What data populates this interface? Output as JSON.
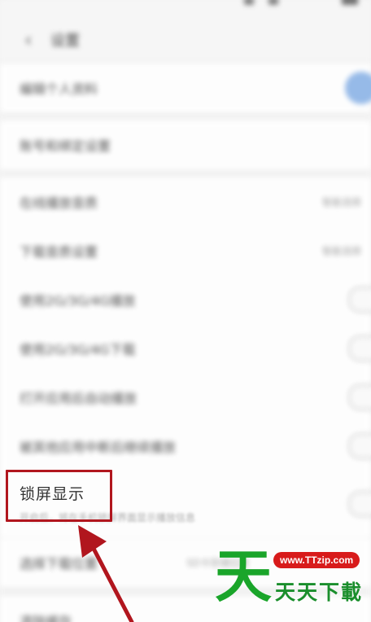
{
  "nav": {
    "title": "设置",
    "back_icon": "‹"
  },
  "rows": [
    {
      "label": "编辑个人资料",
      "value": ""
    },
    {
      "label": "账号和绑定设置",
      "value": ""
    },
    {
      "label": "在线播放音质",
      "value": "智能选择"
    },
    {
      "label": "下载音质设置",
      "value": "智能选择"
    },
    {
      "label": "使用2G/3G/4G播放",
      "value": ""
    },
    {
      "label": "使用2G/3G/4G下载",
      "value": ""
    },
    {
      "label": "打开应用后自动播放",
      "value": ""
    },
    {
      "label": "被其他应用中断后继续播放",
      "value": ""
    },
    {
      "label": "选择下载位置",
      "value": "SD卡存储位置"
    },
    {
      "label": "清除缓存",
      "value": ""
    }
  ],
  "lock_screen": {
    "label": "锁屏显示",
    "subtitle": "开启后，将在手机锁屏界面显示播放信息"
  },
  "watermark": {
    "big": "天",
    "url": "www.TTzip.com",
    "small": "天天下載"
  },
  "colors": {
    "highlight": "#b1161e",
    "watermark_green": "#1aa52a",
    "watermark_red": "#d81b1b"
  }
}
